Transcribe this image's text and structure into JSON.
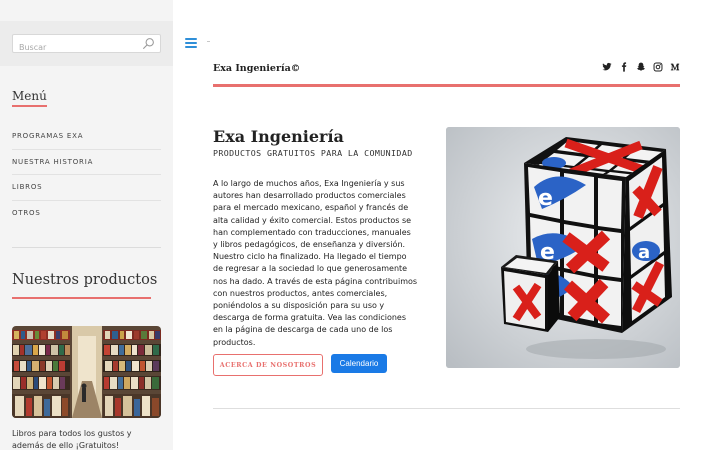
{
  "sidebar": {
    "search": {
      "placeholder": "Buscar"
    },
    "menu_title": "Menú",
    "menu_items": [
      {
        "label": "PROGRAMAS EXA"
      },
      {
        "label": "NUESTRA HISTORIA"
      },
      {
        "label": "LIBROS"
      },
      {
        "label": "OTROS"
      }
    ],
    "products_title": "Nuestros productos",
    "books_caption": "Libros para todos los gustos y además de ello ¡Gratuitos!"
  },
  "header": {
    "site_title": "Exa Ingeniería©",
    "social_icons": [
      "twitter-icon",
      "facebook-icon",
      "snapchat-icon",
      "instagram-icon",
      "medium-icon"
    ]
  },
  "hero": {
    "title": "Exa Ingeniería",
    "subtitle": "PRODUCTOS GRATUITOS PARA LA COMUNIDAD",
    "body": "A lo largo de muchos años, Exa Ingeniería y sus autores han desarrollado productos comerciales para el mercado mexicano, español y francés de alta calidad y éxito comercial. Estos productos se han complementado con traducciones, manuales y libros pedagógicos, de enseñanza y diversión. Nuestro ciclo ha finalizado. Ha llegado el tiempo de regresar a la sociedad lo que generosamente nos ha dado. A través de esta página contribuimos con nuestros productos, antes comerciales, poniéndolos a su disposición para su uso y descarga de forma gratuita. Vea las condiciones en la página de descarga de cada uno de los productos.",
    "button_about": "ACERCA DE NOSOTROS",
    "button_calendar": "Calendario"
  },
  "colors": {
    "accent": "#e8706e",
    "primary_button": "#1a7ae6",
    "hamburger": "#2f8fd8",
    "sidebar_bg": "#f4f4f4"
  }
}
